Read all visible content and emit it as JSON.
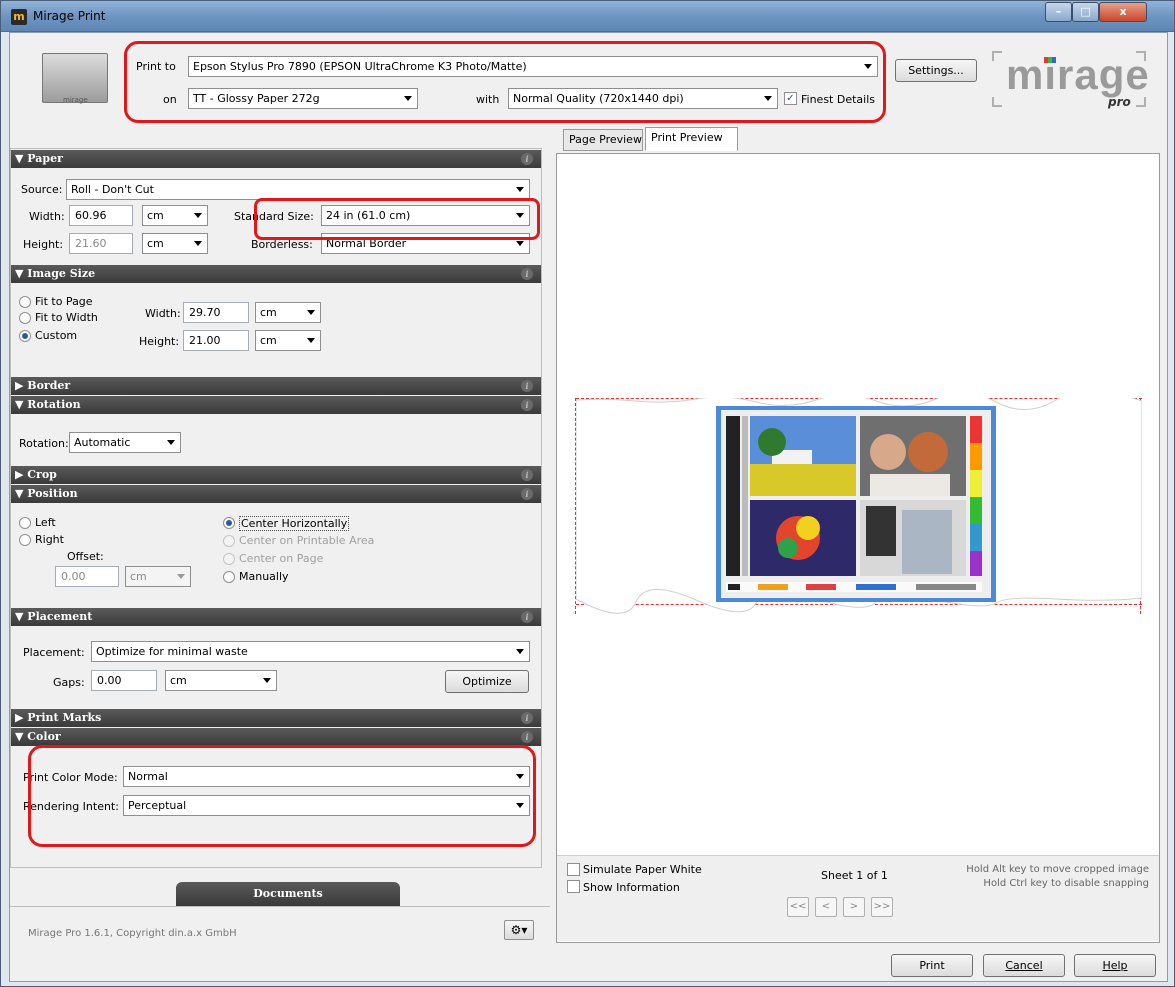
{
  "window": {
    "title": "Mirage Print",
    "app_icon": "m",
    "minimize": "–",
    "maximize": "□",
    "close": "x"
  },
  "printer_badge": "mirage",
  "top": {
    "print_to_label": "Print to",
    "print_to_value": "Epson Stylus Pro 7890 (EPSON UltraChrome K3 Photo/Matte)",
    "on_label": "on",
    "on_value": "TT - Glossy Paper 272g",
    "with_label": "with",
    "with_value": "Normal Quality (720x1440 dpi)",
    "finest_details_label": "Finest Details",
    "finest_details_checked": true,
    "settings_button": "Settings..."
  },
  "logo": {
    "text": "mirage",
    "suffix": "pro"
  },
  "sections": {
    "paper": "Paper",
    "image_size": "Image Size",
    "border": "Border",
    "rotation": "Rotation",
    "crop": "Crop",
    "position": "Position",
    "placement": "Placement",
    "print_marks": "Print Marks",
    "color": "Color",
    "info_icon": "i"
  },
  "paper": {
    "source_label": "Source:",
    "source_value": "Roll - Don't Cut",
    "width_label": "Width:",
    "width_value": "60.96",
    "width_unit": "cm",
    "height_label": "Height:",
    "height_value": "21.60",
    "height_unit": "cm",
    "standard_size_label": "Standard Size:",
    "standard_size_value": "24 in (61.0 cm)",
    "borderless_label": "Borderless:",
    "borderless_value": "Normal Border"
  },
  "image_size": {
    "fit_to_page": "Fit to Page",
    "fit_to_width": "Fit to Width",
    "custom": "Custom",
    "width_label": "Width:",
    "width_value": "29.70",
    "width_unit": "cm",
    "height_label": "Height:",
    "height_value": "21.00",
    "height_unit": "cm"
  },
  "rotation": {
    "label": "Rotation:",
    "value": "Automatic"
  },
  "position": {
    "left": "Left",
    "right": "Right",
    "offset_label": "Offset:",
    "offset_value": "0.00",
    "offset_unit": "cm",
    "center_horizontally": "Center Horizontally",
    "center_printable": "Center on Printable Area",
    "center_page": "Center on Page",
    "manually": "Manually"
  },
  "placement": {
    "label": "Placement:",
    "value": "Optimize for minimal waste",
    "gaps_label": "Gaps:",
    "gaps_value": "0.00",
    "gaps_unit": "cm",
    "optimize_button": "Optimize"
  },
  "color": {
    "mode_label": "Print Color Mode:",
    "mode_value": "Normal",
    "intent_label": "Rendering Intent:",
    "intent_value": "Perceptual"
  },
  "preview": {
    "tabs": [
      "Page Preview",
      "Print Preview"
    ],
    "simulate_paper_white": "Simulate Paper White",
    "show_information": "Show Information",
    "sheet": "Sheet 1 of 1",
    "hint1": "Hold Alt key to move cropped image",
    "hint2": "Hold Ctrl key to disable snapping",
    "nav": [
      "<<",
      "<",
      ">",
      ">>"
    ]
  },
  "footer": {
    "documents_tab": "Documents",
    "copyright": "Mirage Pro 1.6.1, Copyright din.a.x GmbH",
    "print_button": "Print",
    "cancel_button": "Cancel",
    "help_button": "Help"
  },
  "colors": {
    "header_bg": "#3e3e3e",
    "highlight": "#e0181c",
    "accent": "#2859a6"
  }
}
